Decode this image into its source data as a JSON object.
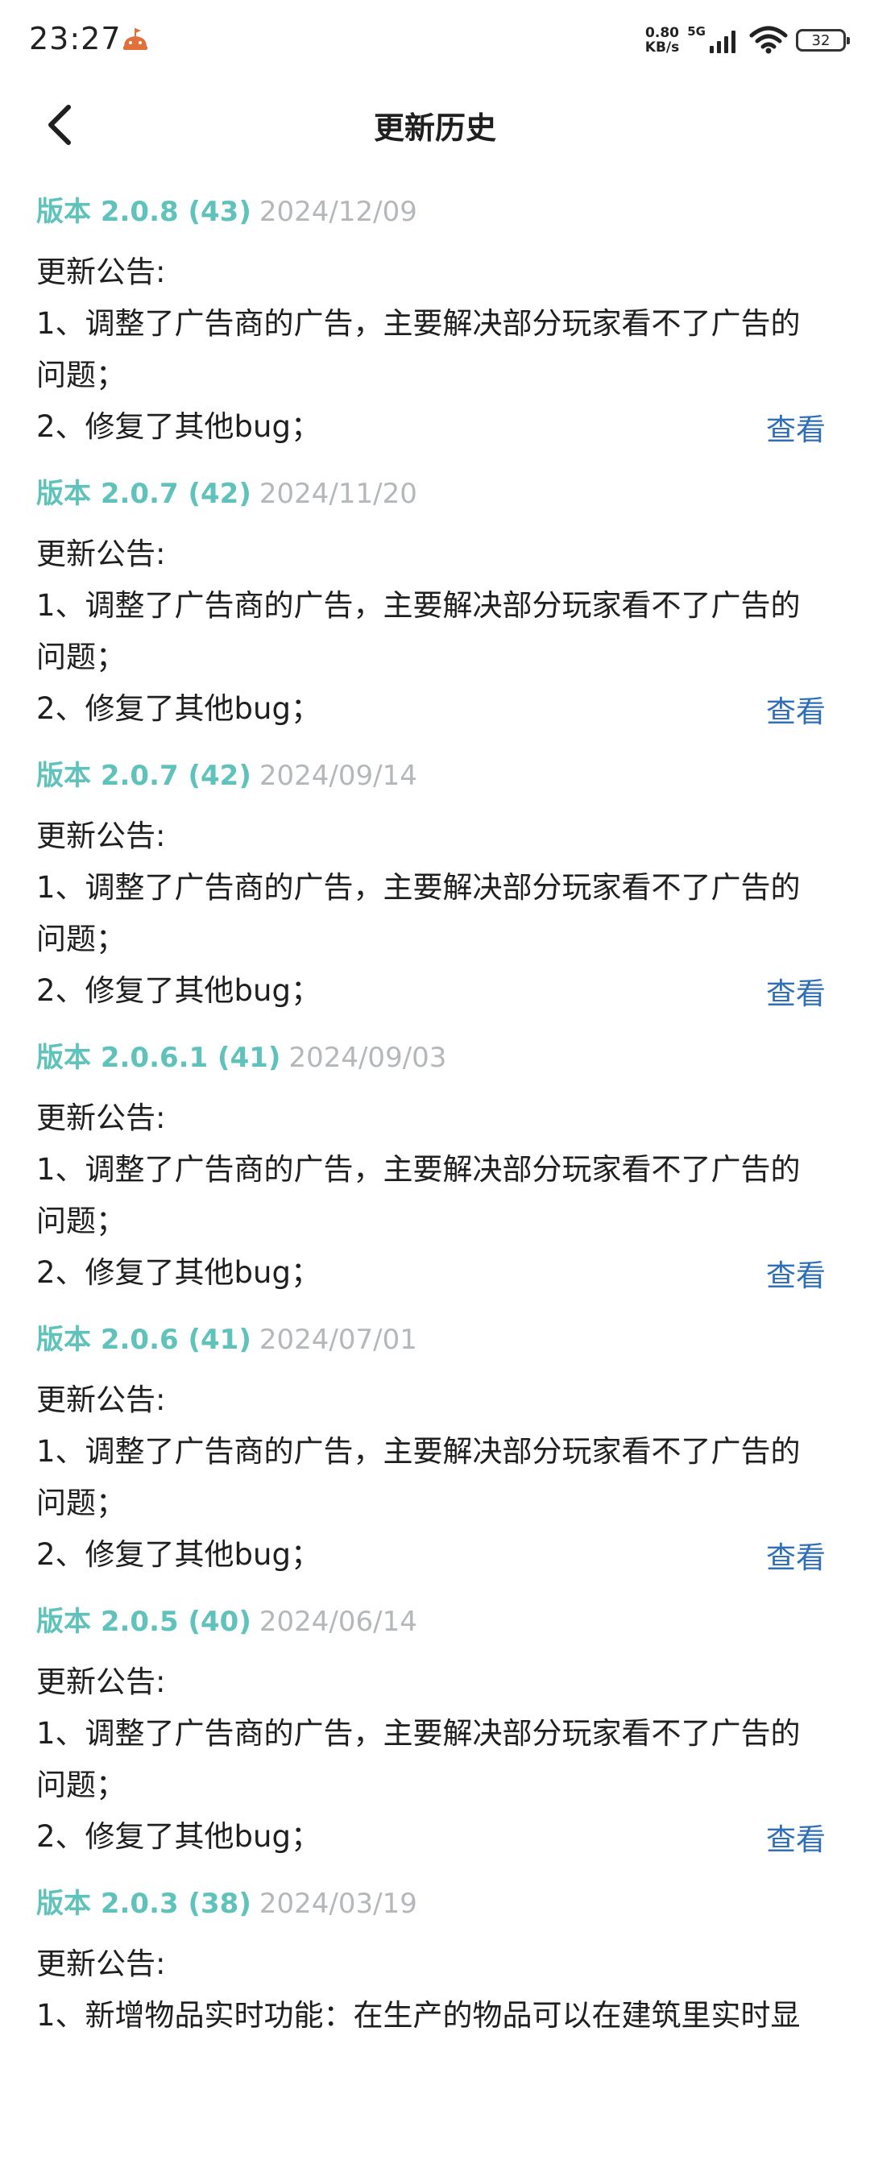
{
  "status_bar": {
    "time": "23:27",
    "net_speed_value": "0.80",
    "net_speed_unit": "KB/s",
    "network_type": "5G",
    "battery": "32"
  },
  "header": {
    "title": "更新历史"
  },
  "entries": [
    {
      "version": "版本 2.0.8 (43)",
      "date": "2024/12/09",
      "notice_label": "更新公告:",
      "line1": "1、调整了广告商的广告，主要解决部分玩家看不了广告的",
      "line1_cont": "问题；",
      "line2": "2、修复了其他bug；",
      "view_label": "查看"
    },
    {
      "version": "版本 2.0.7 (42)",
      "date": "2024/11/20",
      "notice_label": "更新公告:",
      "line1": "1、调整了广告商的广告，主要解决部分玩家看不了广告的",
      "line1_cont": "问题；",
      "line2": "2、修复了其他bug；",
      "view_label": "查看"
    },
    {
      "version": "版本 2.0.7 (42)",
      "date": "2024/09/14",
      "notice_label": "更新公告:",
      "line1": "1、调整了广告商的广告，主要解决部分玩家看不了广告的",
      "line1_cont": "问题；",
      "line2": "2、修复了其他bug；",
      "view_label": "查看"
    },
    {
      "version": "版本 2.0.6.1 (41)",
      "date": "2024/09/03",
      "notice_label": "更新公告:",
      "line1": "1、调整了广告商的广告，主要解决部分玩家看不了广告的",
      "line1_cont": "问题；",
      "line2": "2、修复了其他bug；",
      "view_label": "查看"
    },
    {
      "version": "版本 2.0.6 (41)",
      "date": "2024/07/01",
      "notice_label": "更新公告:",
      "line1": "1、调整了广告商的广告，主要解决部分玩家看不了广告的",
      "line1_cont": "问题；",
      "line2": "2、修复了其他bug；",
      "view_label": "查看"
    },
    {
      "version": "版本 2.0.5 (40)",
      "date": "2024/06/14",
      "notice_label": "更新公告:",
      "line1": "1、调整了广告商的广告，主要解决部分玩家看不了广告的",
      "line1_cont": "问题；",
      "line2": "2、修复了其他bug；",
      "view_label": "查看"
    },
    {
      "version": "版本 2.0.3 (38)",
      "date": "2024/03/19",
      "notice_label": "更新公告:",
      "line1": "1、新增物品实时功能：在生产的物品可以在建筑里实时显"
    }
  ]
}
